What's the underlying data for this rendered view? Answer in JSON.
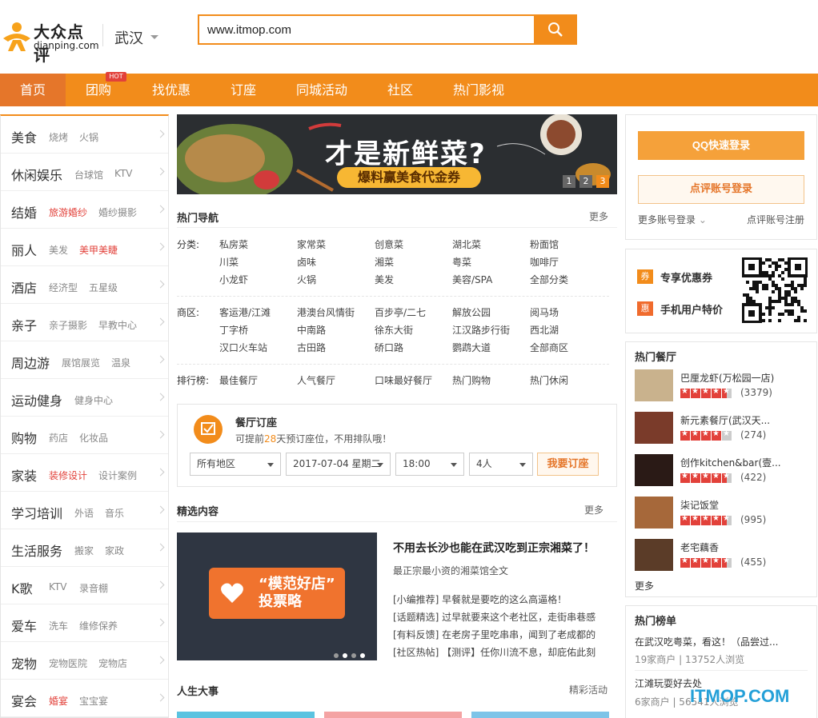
{
  "header": {
    "logo_cn": "大众点评",
    "logo_en": "dianping.com",
    "city": "武汉",
    "search_value": "www.itmop.com"
  },
  "nav": {
    "items": [
      "首页",
      "团购",
      "找优惠",
      "订座",
      "同城活动",
      "社区",
      "热门影视"
    ],
    "hot_badge": "HOT"
  },
  "sidebar": {
    "categories": [
      {
        "name": "美食",
        "subs": [
          "烧烤",
          "火锅"
        ]
      },
      {
        "name": "休闲娱乐",
        "subs": [
          "台球馆",
          "KTV"
        ]
      },
      {
        "name": "结婚",
        "subs": [
          "旅游婚纱",
          "婚纱摄影"
        ]
      },
      {
        "name": "丽人",
        "subs": [
          "美发",
          "美甲美睫"
        ]
      },
      {
        "name": "酒店",
        "subs": [
          "经济型",
          "五星级"
        ]
      },
      {
        "name": "亲子",
        "subs": [
          "亲子摄影",
          "早教中心"
        ]
      },
      {
        "name": "周边游",
        "subs": [
          "展馆展览",
          "温泉"
        ]
      },
      {
        "name": "运动健身",
        "subs": [
          "健身中心"
        ]
      },
      {
        "name": "购物",
        "subs": [
          "药店",
          "化妆品"
        ]
      },
      {
        "name": "家装",
        "subs": [
          "装修设计",
          "设计案例"
        ]
      },
      {
        "name": "学习培训",
        "subs": [
          "外语",
          "音乐"
        ]
      },
      {
        "name": "生活服务",
        "subs": [
          "搬家",
          "家政"
        ]
      },
      {
        "name": "K歌",
        "subs": [
          "KTV",
          "录音棚"
        ]
      },
      {
        "name": "爱车",
        "subs": [
          "洗车",
          "维修保养"
        ]
      },
      {
        "name": "宠物",
        "subs": [
          "宠物医院",
          "宠物店"
        ]
      },
      {
        "name": "宴会",
        "subs": [
          "婚宴",
          "宝宝宴"
        ]
      }
    ]
  },
  "banner": {
    "title": "才是新鲜菜?",
    "cta": "爆料赢美食代金券",
    "dots": [
      "1",
      "2",
      "3"
    ]
  },
  "hot_nav": {
    "title": "热门导航",
    "more": "更多",
    "fenlei_label": "分类:",
    "fenlei": [
      "私房菜",
      "家常菜",
      "创意菜",
      "湖北菜",
      "粉面馆",
      "川菜",
      "卤味",
      "湘菜",
      "粤菜",
      "咖啡厅",
      "小龙虾",
      "火锅",
      "美发",
      "美容/SPA",
      "全部分类"
    ],
    "shangqu_label": "商区:",
    "shangqu": [
      "客运港/江滩",
      "港澳台风情街",
      "百步亭/二七",
      "解放公园",
      "阅马场",
      "丁字桥",
      "中南路",
      "徐东大街",
      "江汉路步行街",
      "西北湖",
      "汉口火车站",
      "古田路",
      "硚口路",
      "鹦鹉大道",
      "全部商区"
    ],
    "paihang_label": "排行榜:",
    "paihang": [
      "最佳餐厅",
      "人气餐厅",
      "口味最好餐厅",
      "热门购物",
      "热门休闲"
    ]
  },
  "booking": {
    "title": "餐厅订座",
    "sub_pre": "可提前",
    "sub_days": "28",
    "sub_post": "天预订座位，不用排队哦！",
    "area": "所有地区",
    "date": "2017-07-04 星期二",
    "time": "18:00",
    "people": "4人",
    "button": "我要订座"
  },
  "featured": {
    "title": "精选内容",
    "more": "更多",
    "sign_text": "“模范好店” 投票略",
    "article_title": "不用去长沙也能在武汉吃到正宗湘菜了！",
    "article_sub": "最正宗最小资的湘菜馆全文",
    "lines": [
      "[小编推荐] 早餐就是要吃的这么高逼格！",
      "[话题精选] 过早就要来这个老社区，走街串巷感",
      "[有料反馈] 在老房子里吃串串，闻到了老成都的",
      "[社区热帖] 【测评】任你川流不息，却庇佑此刻"
    ]
  },
  "life": {
    "title": "人生大事",
    "more": "精彩活动"
  },
  "login": {
    "qq": "QQ快速登录",
    "dianping": "点评账号登录",
    "more": "更多账号登录",
    "register": "点评账号注册"
  },
  "promo": {
    "items": [
      {
        "icon": "券",
        "text": "专享优惠券"
      },
      {
        "icon": "惠",
        "text": "手机用户特价"
      }
    ]
  },
  "hot_restaurants": {
    "title": "热门餐厅",
    "items": [
      {
        "name": "巴厘龙虾(万松园一店)",
        "count": "(3379)",
        "stars": 4.5
      },
      {
        "name": "新元素餐厅(武汉天...",
        "count": "(274)",
        "stars": 4
      },
      {
        "name": "创作kitchen&bar(壹...",
        "count": "(422)",
        "stars": 4.5
      },
      {
        "name": "柒记饭堂",
        "count": "(995)",
        "stars": 4.5
      },
      {
        "name": "老宅藕香",
        "count": "(455)",
        "stars": 4.5
      }
    ],
    "more": "更多"
  },
  "hot_list": {
    "title": "热门榜单",
    "items": [
      {
        "name": "在武汉吃粤菜，看这！（品尝过...",
        "meta": "19家商户  |  13752人浏览"
      },
      {
        "name": "江滩玩耍好去处",
        "meta": "6家商户  |  56541人浏览"
      }
    ]
  },
  "watermark": "ITMOP.COM",
  "colors": {
    "brand": "#f28c1b",
    "hot": "#e2413a"
  }
}
